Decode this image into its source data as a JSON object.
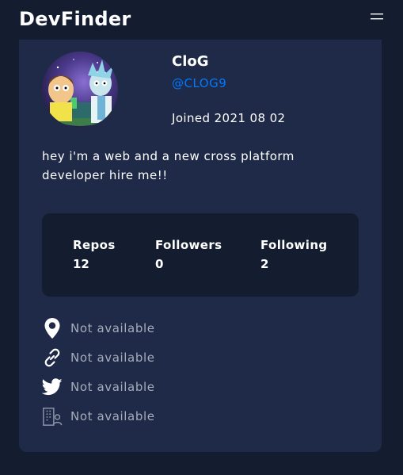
{
  "app": {
    "title": "DevFinder"
  },
  "profile": {
    "name": "CloG",
    "login": "@CLOG9",
    "joined": "Joined 2021 08 02",
    "bio": "hey i'm a web and a new cross platform developer hire me!!"
  },
  "stats": {
    "repos_label": "Repos",
    "repos_value": "12",
    "followers_label": "Followers",
    "followers_value": "0",
    "following_label": "Following",
    "following_value": "2"
  },
  "links": {
    "location": {
      "icon": "location-pin-icon",
      "text": "Not available"
    },
    "website": {
      "icon": "link-icon",
      "text": "Not available"
    },
    "twitter": {
      "icon": "twitter-icon",
      "text": "Not available"
    },
    "company": {
      "icon": "building-icon",
      "text": "Not available"
    }
  },
  "colors": {
    "background": "#141d2f",
    "card": "#1e2a47",
    "accent": "#0079ff",
    "muted": "#a6adba"
  }
}
